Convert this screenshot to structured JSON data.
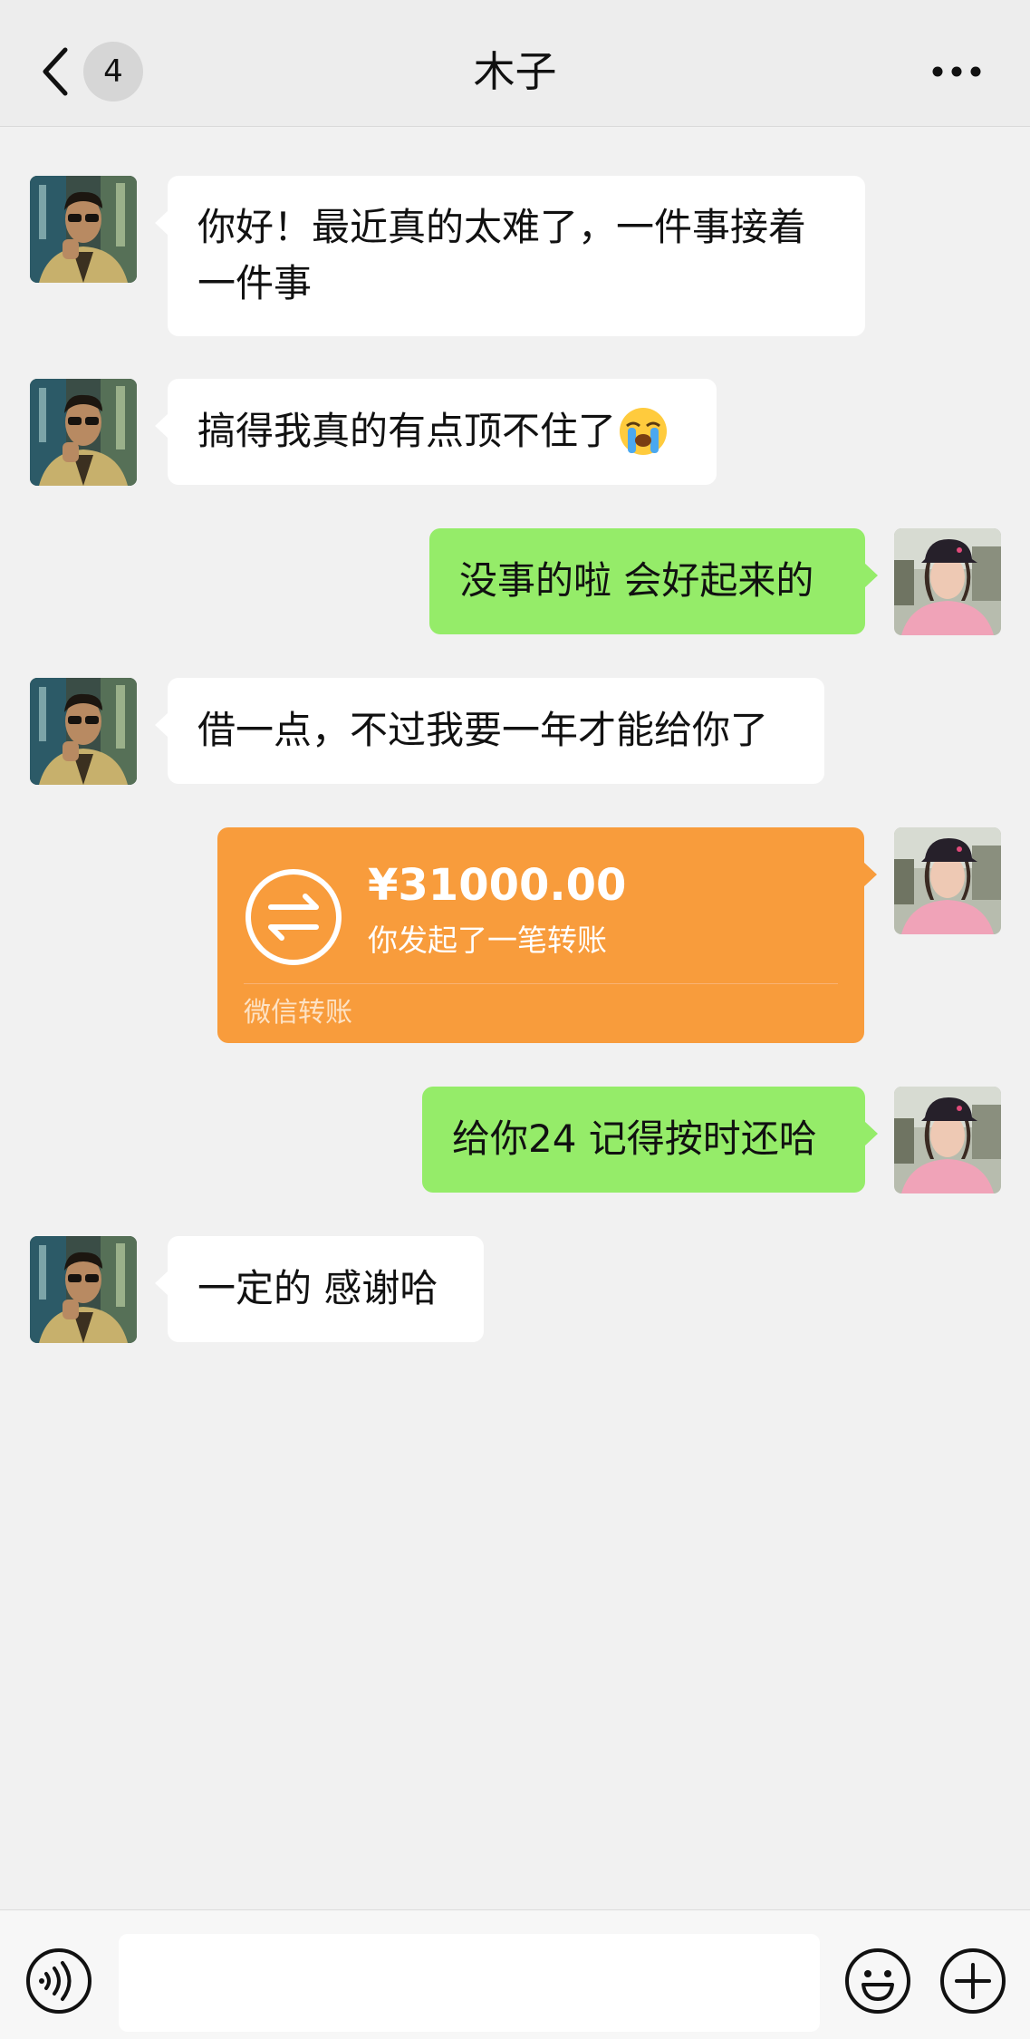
{
  "header": {
    "unread_count": "4",
    "title": "木子",
    "back_icon": "chevron-left-icon",
    "more_icon": "ellipsis-icon"
  },
  "messages": [
    {
      "from": "contact",
      "type": "text",
      "lines": [
        "你好！最近真的太难了，一件事接着",
        "一件事"
      ]
    },
    {
      "from": "contact",
      "type": "text",
      "text": "搞得我真的有点顶不住了",
      "emoji": "crying-face-emoji"
    },
    {
      "from": "me",
      "type": "text",
      "text": "没事的啦  会好起来的"
    },
    {
      "from": "contact",
      "type": "text",
      "text": "借一点，不过我要一年才能给你了"
    },
    {
      "from": "me",
      "type": "transfer",
      "amount": "¥31000.00",
      "description": "你发起了一笔转账",
      "footer": "微信转账",
      "icon": "transfer-icon"
    },
    {
      "from": "me",
      "type": "text",
      "text": "给你24  记得按时还哈"
    },
    {
      "from": "contact",
      "type": "text",
      "text": "一定的  感谢哈"
    }
  ],
  "input_bar": {
    "value": "",
    "voice_icon": "voice-icon",
    "emoji_icon": "emoji-icon",
    "plus_icon": "plus-icon"
  },
  "colors": {
    "background": "#f1f1f1",
    "incoming_bubble": "#ffffff",
    "outgoing_bubble": "#95ec69",
    "transfer_card": "#f89c3c"
  }
}
